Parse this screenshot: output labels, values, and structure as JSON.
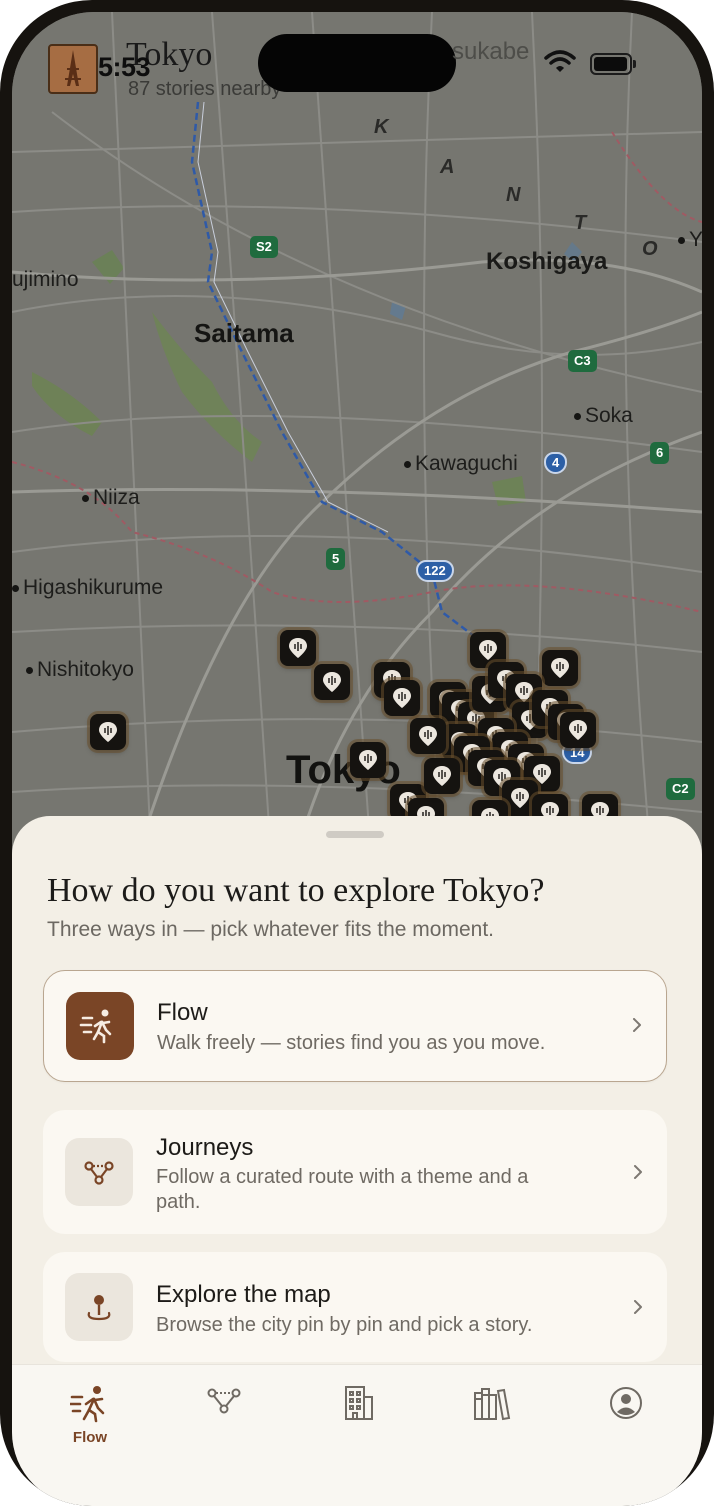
{
  "status_bar": {
    "time": "5:53",
    "carrier_fragment": "sukabe"
  },
  "header": {
    "city": "Tokyo",
    "subtitle": "87 stories nearby"
  },
  "map": {
    "places": [
      {
        "id": "ujimino",
        "label": "ujimino"
      },
      {
        "id": "saitama",
        "label": "Saitama"
      },
      {
        "id": "koshigaya",
        "label": "Koshigaya"
      },
      {
        "id": "soka",
        "label": "Soka"
      },
      {
        "id": "kawaguchi",
        "label": "Kawaguchi"
      },
      {
        "id": "niiza",
        "label": "Niiza"
      },
      {
        "id": "higashikurume",
        "label": "Higashikurume"
      },
      {
        "id": "nishitokyo",
        "label": "Nishitokyo"
      },
      {
        "id": "tokyo",
        "label": "Tokyo"
      },
      {
        "id": "y",
        "label": "Y"
      }
    ],
    "region_letters": [
      "K",
      "A",
      "N",
      "T",
      "O"
    ],
    "route_shields": [
      "S2",
      "C3",
      "6",
      "4",
      "5",
      "122",
      "14",
      "C2"
    ]
  },
  "sheet": {
    "title": "How do you want to explore Tokyo?",
    "subtitle": "Three ways in — pick whatever fits the moment.",
    "options": [
      {
        "title": "Flow",
        "description": "Walk freely — stories find you as you move.",
        "icon": "walking-person-icon",
        "selected": true
      },
      {
        "title": "Journeys",
        "description": "Follow a curated route with a theme and a path.",
        "icon": "route-nodes-icon",
        "selected": false
      },
      {
        "title": "Explore the map",
        "description": "Browse the city pin by pin and pick a story.",
        "icon": "map-pin-icon",
        "selected": false
      }
    ]
  },
  "tabbar": {
    "active_label": "Flow",
    "tabs": [
      {
        "icon": "walking-person-icon",
        "label": "Flow"
      },
      {
        "icon": "route-nodes-icon",
        "label": ""
      },
      {
        "icon": "building-icon",
        "label": ""
      },
      {
        "icon": "library-icon",
        "label": ""
      },
      {
        "icon": "profile-icon",
        "label": ""
      }
    ]
  },
  "colors": {
    "accent": "#7a4526",
    "sheet_bg": "#f3efe6",
    "card_bg": "#fbf8f2"
  }
}
